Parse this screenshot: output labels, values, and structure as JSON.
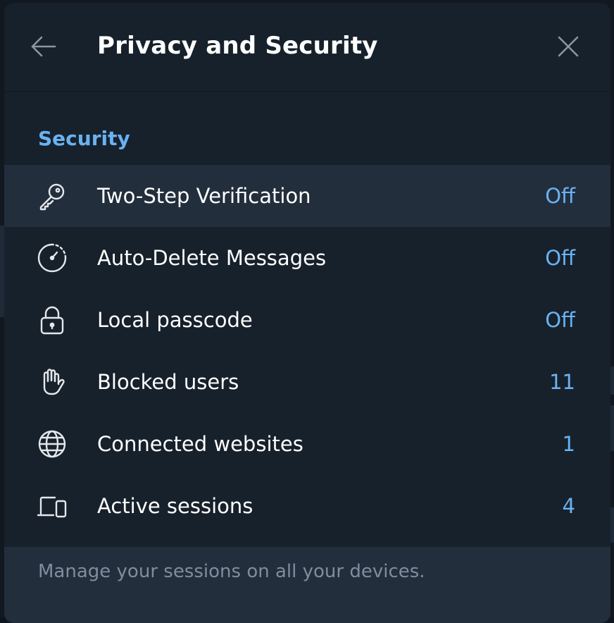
{
  "header": {
    "title": "Privacy and Security",
    "back_icon": "arrow-left-icon",
    "close_icon": "close-icon"
  },
  "section": {
    "title": "Security"
  },
  "items": [
    {
      "label": "Two-Step Verification",
      "value": "Off",
      "icon": "key-icon"
    },
    {
      "label": "Auto-Delete Messages",
      "value": "Off",
      "icon": "timer-icon"
    },
    {
      "label": "Local passcode",
      "value": "Off",
      "icon": "lock-icon"
    },
    {
      "label": "Blocked users",
      "value": "11",
      "icon": "hand-icon"
    },
    {
      "label": "Connected websites",
      "value": "1",
      "icon": "globe-icon"
    },
    {
      "label": "Active sessions",
      "value": "4",
      "icon": "devices-icon"
    }
  ],
  "footer": {
    "text": "Manage your sessions on all your devices."
  },
  "colors": {
    "background": "#17212b",
    "accent": "#6ab2f2",
    "hover": "#232e3c",
    "muted_text": "#7f8d9c",
    "icon": "#e4e8ec"
  }
}
